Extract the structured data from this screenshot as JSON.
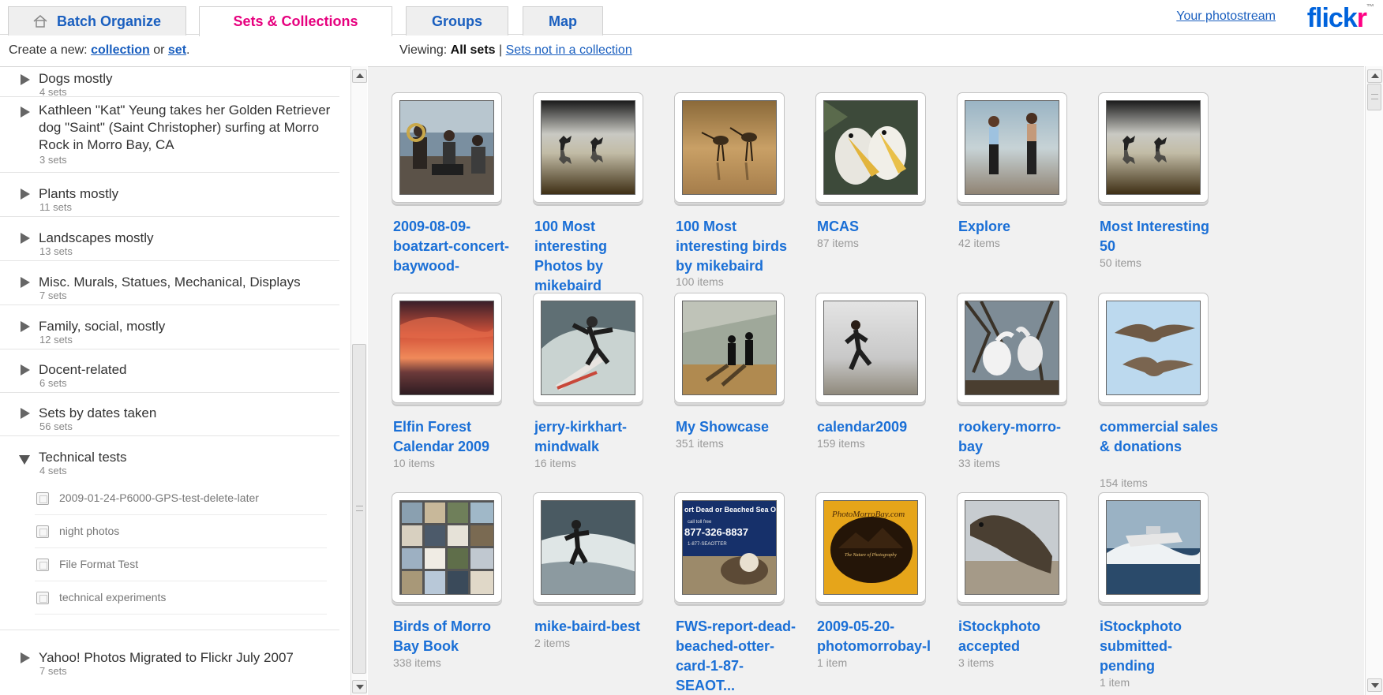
{
  "tabs": {
    "batch": "Batch Organize",
    "sets": "Sets & Collections",
    "groups": "Groups",
    "map": "Map"
  },
  "header": {
    "photostream_link": "Your photostream",
    "logo_part1": "flick",
    "logo_part2": "r",
    "logo_tm": "™"
  },
  "toolbar": {
    "create_prefix": "Create a new:",
    "collection_link": "collection",
    "or_text": "or",
    "set_link": "set",
    "period": ".",
    "viewing_label": "Viewing:",
    "all_sets": "All sets",
    "separator": "|",
    "not_in_collection_link": "Sets not in a collection"
  },
  "collections": [
    {
      "title": "Dogs mostly",
      "count": "4 sets"
    },
    {
      "title": "Kathleen \"Kat\" Yeung takes her Golden Retriever dog \"Saint\" (Saint Christopher) surfing at Morro Rock in Morro Bay, CA",
      "count": "3 sets"
    },
    {
      "title": "Plants mostly",
      "count": "11 sets"
    },
    {
      "title": "Landscapes mostly",
      "count": "13 sets"
    },
    {
      "title": "Misc. Murals, Statues, Mechanical, Displays",
      "count": "7 sets"
    },
    {
      "title": "Family, social, mostly",
      "count": "12 sets"
    },
    {
      "title": "Docent-related",
      "count": "6 sets"
    },
    {
      "title": "Sets by dates taken",
      "count": "56 sets"
    },
    {
      "title": "Technical tests",
      "count": "4 sets"
    },
    {
      "title": "Yahoo! Photos Migrated to Flickr July 2007",
      "count": "7 sets"
    }
  ],
  "technical_sets": [
    "2009-01-24-P6000-GPS-test-delete-later",
    "night photos",
    "File Format Test",
    "technical experiments"
  ],
  "sets": [
    {
      "title": "2009-08-09-boatzart-concert-baywood-",
      "items": "",
      "icon": "band-concert-photo"
    },
    {
      "title": "100 Most interesting Photos by mikebaird",
      "items": "",
      "icon": "reflected-birds-photo"
    },
    {
      "title": "100 Most interesting birds by mikebaird",
      "items": "100 items",
      "icon": "shorebirds-photo"
    },
    {
      "title": "MCAS",
      "items": "87 items",
      "icon": "pelican-heads-photo"
    },
    {
      "title": "Explore",
      "items": "42 items",
      "icon": "beach-walkers-photo"
    },
    {
      "title": "Most Interesting 50",
      "items": "50 items",
      "icon": "reflected-birds-photo"
    },
    {
      "title": "Elfin Forest Calendar 2009",
      "items": "10 items",
      "icon": "sunset-photo"
    },
    {
      "title": "jerry-kirkhart-mindwalk",
      "items": "16 items",
      "icon": "surfer-photo"
    },
    {
      "title": "My Showcase",
      "items": "351 items",
      "icon": "couple-silhouette-photo"
    },
    {
      "title": "calendar2009",
      "items": "159 items",
      "icon": "runner-photo"
    },
    {
      "title": "rookery-morro-bay",
      "items": "33 items",
      "icon": "egrets-photo"
    },
    {
      "title": "commercial sales & donations",
      "items": "154 items",
      "icon": "pelicans-flight-photo"
    },
    {
      "title": "Birds of Morro Bay Book",
      "items": "338 items",
      "icon": "bird-collage-photo"
    },
    {
      "title": "mike-baird-best",
      "items": "2 items",
      "icon": "surfer-wave-photo"
    },
    {
      "title": "FWS-report-dead-beached-otter-card-1-87-SEAOT...",
      "items": "",
      "icon": "otter-card-photo"
    },
    {
      "title": "2009-05-20-photomorrobay-l",
      "items": "1 item",
      "icon": "photomorrobay-logo-photo"
    },
    {
      "title": "iStockphoto accepted",
      "items": "3 items",
      "icon": "elephant-seal-photo"
    },
    {
      "title": "iStockphoto submitted-pending",
      "items": "1 item",
      "icon": "boat-wave-photo"
    }
  ],
  "otter_card_text": [
    "ort Dead or Beached Sea Ot",
    "call toll free",
    "877-326-8837",
    "1-877-SEAOTTER"
  ],
  "logo_card_text": [
    "PhotoMorroBay.com",
    "The Nature of Photography"
  ],
  "colors": {
    "link": "#1a6fd6",
    "active_tab": "#e6007e",
    "flickr_blue": "#0063dc",
    "flickr_pink": "#ff0084",
    "panel_bg": "#f1f1f1"
  }
}
